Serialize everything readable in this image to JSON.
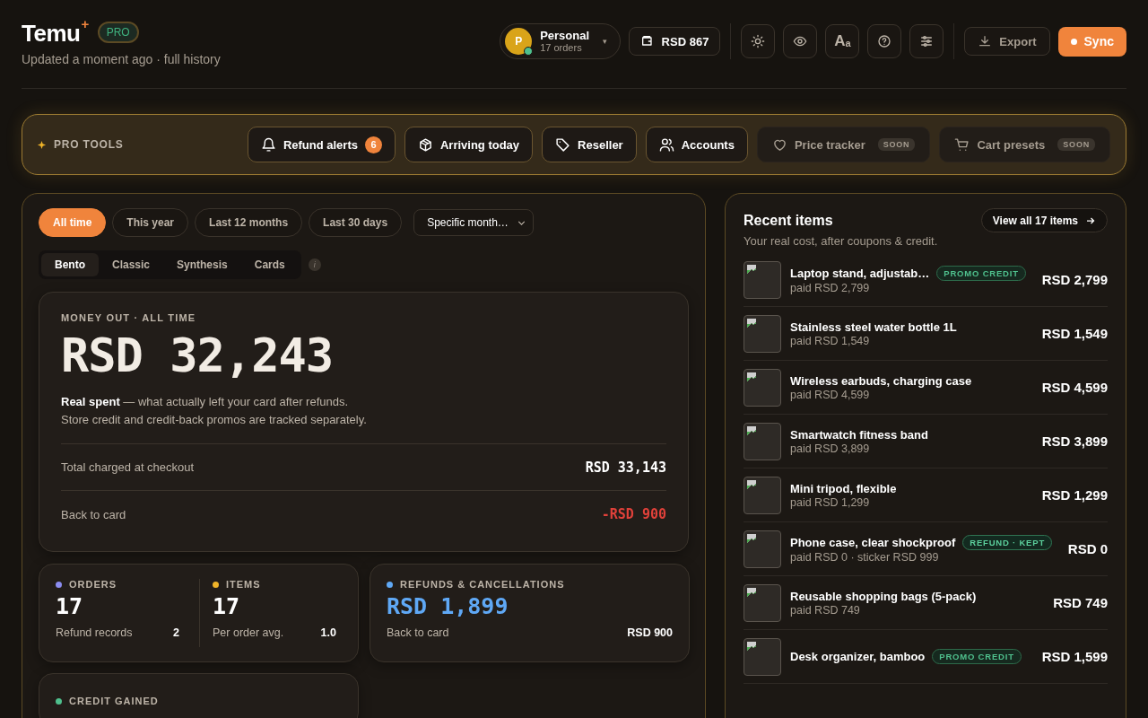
{
  "header": {
    "brand": "Temu",
    "brand_mark": "+",
    "badge": "PRO",
    "subtitle": "Updated a moment ago · full history"
  },
  "account": {
    "initial": "P",
    "name": "Personal",
    "orders": "17 orders",
    "online": true,
    "caret": "▾"
  },
  "balance": "RSD 867",
  "icon_buttons": [
    {
      "kind": "sun"
    },
    {
      "kind": "eye"
    },
    {
      "kind": "font",
      "big": "A",
      "small": "a"
    },
    {
      "kind": "help"
    },
    {
      "kind": "sliders"
    }
  ],
  "export": "Export",
  "sync": "Sync",
  "pro_tools": {
    "label": "PRO TOOLS",
    "tools": [
      {
        "kind": "bell",
        "label": "Refund alerts",
        "count": "6",
        "disabled": false
      },
      {
        "kind": "box",
        "label": "Arriving today",
        "disabled": false
      },
      {
        "kind": "tag",
        "label": "Reseller",
        "disabled": false
      },
      {
        "kind": "users",
        "label": "Accounts",
        "disabled": false
      },
      {
        "kind": "heart",
        "label": "Price tracker",
        "badge": "SOON",
        "disabled": true
      },
      {
        "kind": "cart",
        "label": "Cart presets",
        "badge": "SOON",
        "disabled": true
      }
    ]
  },
  "ranges": [
    {
      "label": "All time",
      "selected": true
    },
    {
      "label": "This year",
      "selected": false
    },
    {
      "label": "Last 12 months",
      "selected": false
    },
    {
      "label": "Last 30 days",
      "selected": false
    }
  ],
  "month_select": "Specific month…",
  "views": [
    {
      "label": "Bento",
      "selected": true
    },
    {
      "label": "Classic",
      "selected": false
    },
    {
      "label": "Synthesis",
      "selected": false
    },
    {
      "label": "Cards",
      "selected": false
    }
  ],
  "views_info": "i",
  "money": {
    "label": "MONEY OUT · ALL TIME",
    "amount": "RSD 32,243",
    "description": "**Real spent** — what actually left your card after refunds. Store credit and credit-back promos are tracked separately.",
    "rows": [
      {
        "label": "Total charged at checkout",
        "value": "RSD 33,143",
        "negative": false
      },
      {
        "label": "Back to card",
        "value": "-RSD 900",
        "negative": true
      }
    ]
  },
  "stats": {
    "orders": {
      "label": "ORDERS",
      "color": "#8b8cf0",
      "value": "17",
      "sub_label": "Refund records",
      "sub_value": "2"
    },
    "items": {
      "label": "ITEMS",
      "color": "#f0b429",
      "value": "17",
      "sub_label": "Per order avg.",
      "sub_value": "1.0"
    },
    "refunds": {
      "label": "REFUNDS & CANCELLATIONS",
      "color": "#5fa8f5",
      "value": "RSD 1,899",
      "sub_label": "Back to card",
      "sub_value": "RSD 900"
    },
    "credit": {
      "label": "CREDIT GAINED",
      "color": "#4fc08d"
    }
  },
  "recent": {
    "title": "Recent items",
    "subtitle": "Your real cost, after coupons & credit.",
    "link": "View all 17 items",
    "items": [
      {
        "name": "Laptop stand, adjustab…",
        "tag": {
          "kind": "promo",
          "label": "PROMO CREDIT"
        },
        "paid": "paid RSD 2,799",
        "price": "RSD 2,799"
      },
      {
        "name": "Stainless steel water bottle 1L",
        "paid": "paid RSD 1,549",
        "price": "RSD 1,549"
      },
      {
        "name": "Wireless earbuds, charging case",
        "paid": "paid RSD 4,599",
        "price": "RSD 4,599"
      },
      {
        "name": "Smartwatch fitness band",
        "paid": "paid RSD 3,899",
        "price": "RSD 3,899"
      },
      {
        "name": "Mini tripod, flexible",
        "paid": "paid RSD 1,299",
        "price": "RSD 1,299"
      },
      {
        "name": "Phone case, clear shockproof",
        "tag": {
          "kind": "refund",
          "label": "REFUND · KEPT"
        },
        "paid": "paid RSD 0 · sticker RSD 999",
        "price": "RSD 0"
      },
      {
        "name": "Reusable shopping bags (5-pack)",
        "paid": "paid RSD 749",
        "price": "RSD 749"
      },
      {
        "name": "Desk organizer, bamboo",
        "tag": {
          "kind": "promo",
          "label": "PROMO CREDIT"
        },
        "price": "RSD 1,599"
      }
    ]
  }
}
